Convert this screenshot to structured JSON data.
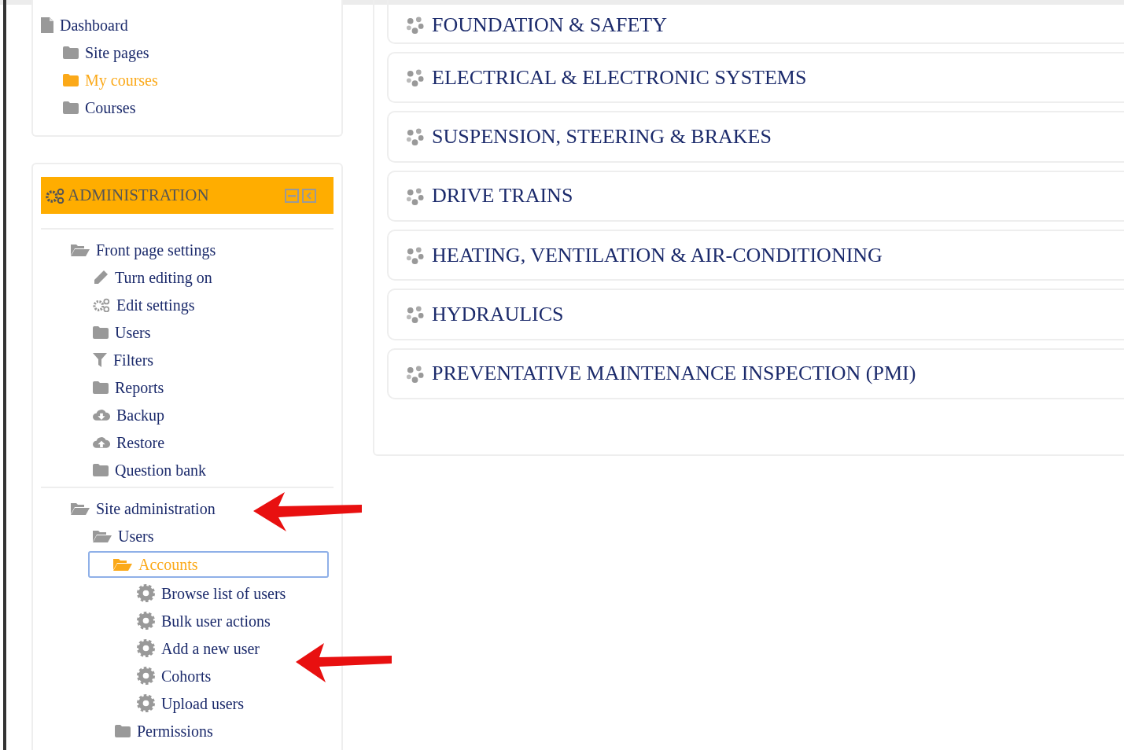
{
  "navigation": {
    "items": [
      {
        "label": "Dashboard",
        "kind": "page",
        "selected": false,
        "focused": false,
        "children": [
          {
            "label": "Site pages",
            "kind": "folder",
            "selected": false,
            "focused": false
          },
          {
            "label": "My courses",
            "kind": "folder",
            "selected": true,
            "focused": false
          },
          {
            "label": "Courses",
            "kind": "folder",
            "selected": false,
            "focused": false
          }
        ]
      }
    ]
  },
  "administration": {
    "title": "ADMINISTRATION",
    "items": [
      {
        "label": "Front page settings",
        "kind": "folder-open",
        "selected": false,
        "focused": false,
        "children": [
          {
            "label": "Turn editing on",
            "kind": "pencil",
            "selected": false,
            "focused": false
          },
          {
            "label": "Edit settings",
            "kind": "gears",
            "selected": false,
            "focused": false
          },
          {
            "label": "Users",
            "kind": "folder",
            "selected": false,
            "focused": false
          },
          {
            "label": "Filters",
            "kind": "filter",
            "selected": false,
            "focused": false
          },
          {
            "label": "Reports",
            "kind": "folder",
            "selected": false,
            "focused": false
          },
          {
            "label": "Backup",
            "kind": "cloud-down",
            "selected": false,
            "focused": false
          },
          {
            "label": "Restore",
            "kind": "cloud-up",
            "selected": false,
            "focused": false
          },
          {
            "label": "Question bank",
            "kind": "folder",
            "selected": false,
            "focused": false
          }
        ]
      },
      {
        "label": "Site administration",
        "kind": "folder-open",
        "selected": false,
        "focused": false,
        "children": [
          {
            "label": "Users",
            "kind": "folder-open",
            "selected": false,
            "focused": false,
            "children": [
              {
                "label": "Accounts",
                "kind": "folder-open",
                "selected": true,
                "focused": true,
                "children": [
                  {
                    "label": "Browse list of users",
                    "kind": "gear",
                    "selected": false,
                    "focused": false
                  },
                  {
                    "label": "Bulk user actions",
                    "kind": "gear",
                    "selected": false,
                    "focused": false
                  },
                  {
                    "label": "Add a new user",
                    "kind": "gear",
                    "selected": false,
                    "focused": false
                  },
                  {
                    "label": "Cohorts",
                    "kind": "gear",
                    "selected": false,
                    "focused": false
                  },
                  {
                    "label": "Upload users",
                    "kind": "gear",
                    "selected": false,
                    "focused": false
                  }
                ]
              },
              {
                "label": "Permissions",
                "kind": "folder",
                "selected": false,
                "focused": false
              }
            ]
          }
        ]
      }
    ]
  },
  "categories": [
    {
      "title": "FOUNDATION & SAFETY"
    },
    {
      "title": "ELECTRICAL & ELECTRONIC SYSTEMS"
    },
    {
      "title": "SUSPENSION, STEERING & BRAKES"
    },
    {
      "title": "DRIVE TRAINS"
    },
    {
      "title": "HEATING, VENTILATION & AIR-CONDITIONING"
    },
    {
      "title": "HYDRAULICS"
    },
    {
      "title": "PREVENTATIVE MAINTENANCE INSPECTION (PMI)"
    }
  ]
}
